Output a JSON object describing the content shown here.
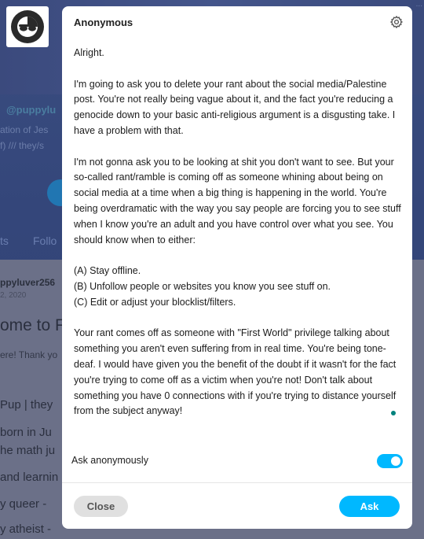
{
  "background": {
    "top_right": "...",
    "handle": "@puppylu",
    "desc_line1": "ation of Jes",
    "desc_line2": "f) /// they/s",
    "desc_line3": "",
    "tab1": "ts",
    "tab2": "Follo",
    "post_author": "ppyluver256",
    "post_date": "2, 2020",
    "post_title": "ome to F",
    "post_thanks": "ere! Thank yo",
    "line1": "Pup | they",
    "line2": "born in Ju",
    "line3": "he math ju",
    "line4": "and learnin",
    "line5": "y queer -",
    "line6": "y atheist -"
  },
  "avatar": {
    "icon": "sunglasses-face-icon"
  },
  "modal": {
    "title": "Anonymous",
    "settings_icon": "gear-icon",
    "message": [
      "Alright.",
      "I'm going to ask you to delete your rant about the social media/Palestine post. You're not really being vague about it, and the fact you're reducing a genocide down to your basic anti-religious argument is a disgusting take. I have a problem with that.",
      "I'm not gonna ask you to be looking at shit you don't want to see. But your so-called rant/ramble is coming off as someone whining about being on social media at a time when a big thing is happening in the world. You're being overdramatic with the way you say people are forcing you to see stuff when I know you're an adult and you have control over what you see. You should know when to either:",
      "(A) Stay offline.\n(B) Unfollow people or websites you know you see stuff on.\n(C) Edit or adjust your blocklist/filters.",
      "Your rant comes off as someone with \"First World\" privilege talking about something you aren't even suffering from in real time. You're being tone-deaf. I would have given you the benefit of the doubt if it wasn't for the fact you're trying to come off as a victim when you're not! Don't talk about something you have 0 connections with if you're trying to distance yourself from the subject anyway!"
    ],
    "anonymous_label": "Ask anonymously",
    "anonymous_enabled": true,
    "close_label": "Close",
    "ask_label": "Ask"
  },
  "colors": {
    "accent": "#00b8ff",
    "indicator": "#00827d"
  }
}
